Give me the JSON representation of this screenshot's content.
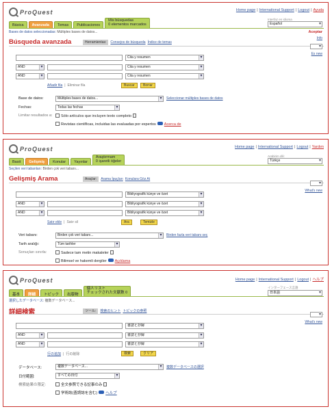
{
  "panels": [
    {
      "lang_code": "es",
      "top_links": [
        "Home page",
        "International Support",
        "Logout",
        "Ayuda"
      ],
      "tabs": [
        "Básica",
        "Avanzada",
        "Temas",
        "Publicaciones"
      ],
      "tab_stack": [
        "Mis búsquedas",
        "0 elementos marcados"
      ],
      "lang_label": "Interfaz en idioma",
      "lang_value": "Español",
      "lang_action": "Aceptar",
      "info_link": "Info",
      "whats_new": "Es new",
      "crumb": "Bases de datos seleccionadas:",
      "crumb_current": "Múltiples bases de datos...",
      "title": "Búsqueda avanzada",
      "subtabs_on": "Herramientas:",
      "subtabs": [
        "Consejos de búsqueda",
        "Índice de temas"
      ],
      "field_value": "Cita y resumen",
      "op_value": "AND",
      "add_row": "Añadir fila",
      "remove_row": "Eliminar fila",
      "search_btn": "Buscar",
      "clear_btn": "Borrar",
      "db_label": "Base de datos:",
      "db_value": "Múltiples bases de datos...",
      "db_link": "Seleccionar múltiples bases de datos",
      "date_label": "Fechas:",
      "date_value": "Todas las fechas",
      "limit_label": "Limitar resultados a:",
      "fulltext": "Sólo artículos que incluyen texto completo",
      "peer": "Revistas científicas, incluidas las evaluadas por expertos",
      "peer_help": "Acerca de"
    },
    {
      "lang_code": "tr",
      "top_links": [
        "Home page",
        "International Support",
        "Logout",
        "Yardım"
      ],
      "tabs": [
        "Basit",
        "Gelişmiş",
        "Konular",
        "Yayınlar"
      ],
      "tab_stack": [
        "Araştırmam",
        "0 işaretli öğeler"
      ],
      "lang_label": "Arabirim dili:",
      "lang_value": "Türkçe",
      "lang_action": "",
      "info_link": "",
      "whats_new": "What's new",
      "crumb": "Seçilen veri tabanları:",
      "crumb_current": "Birden çok veri tabanı...",
      "title": "Gelişmiş Arama",
      "subtabs_on": "Araçlar:",
      "subtabs": [
        "Arama İpuçları",
        "Konulara Göz At"
      ],
      "field_value": "Bibliyografik künye ve özet",
      "op_value": "AND",
      "add_row": "Satır ekle",
      "remove_row": "Satır sil",
      "search_btn": "Ara",
      "clear_btn": "Temizle",
      "db_label": "Veri tabanı:",
      "db_value": "Birden çok veri tabanı...",
      "db_link": "Birden fazla veri tabanı seç",
      "date_label": "Tarih aralığı:",
      "date_value": "Tüm tarihler",
      "limit_label": "Sonuçları sınırla:",
      "fulltext": "Sadece tam metin makaleler",
      "peer": "Bilimsel ve hakemli dergiler",
      "peer_help": "Açıklama"
    },
    {
      "lang_code": "ja",
      "top_links": [
        "Home page",
        "International Support",
        "Logout",
        "ヘルプ"
      ],
      "tabs": [
        "基本",
        "詳細",
        "トピック",
        "出版物"
      ],
      "tab_stack": [
        "個人リスト",
        "チェックされた文献数 0"
      ],
      "lang_label": "インターフェース言語",
      "lang_value": "日本語",
      "lang_action": "",
      "info_link": "",
      "whats_new": "What's new",
      "crumb": "選択したデータベース:",
      "crumb_current": "複数データベース...",
      "title": "詳細検索",
      "subtabs_on": "ツール:",
      "subtabs": [
        "検索のヒント",
        "トピックの参照"
      ],
      "field_value": "書誌と抄録",
      "op_value": "AND",
      "add_row": "行の追加",
      "remove_row": "行の削除",
      "search_btn": "検索",
      "clear_btn": "クリア",
      "db_label": "データベース:",
      "db_value": "複数データベース...",
      "db_link": "複数データベースの選択",
      "date_label": "日付範囲:",
      "date_value": "すべての日付",
      "limit_label": "検索結果の限定:",
      "fulltext": "全文参照できる記事のみ",
      "peer": "学術誌(査読誌を含む)",
      "peer_help": "ヘルプ"
    }
  ],
  "logo_text": "ProQuest",
  "colors": {
    "tab": "#b6d35a",
    "tab_active": "#f0a040",
    "title": "#c62828",
    "link": "#335599",
    "button": "#f2d64a",
    "border": "#c9302c"
  }
}
